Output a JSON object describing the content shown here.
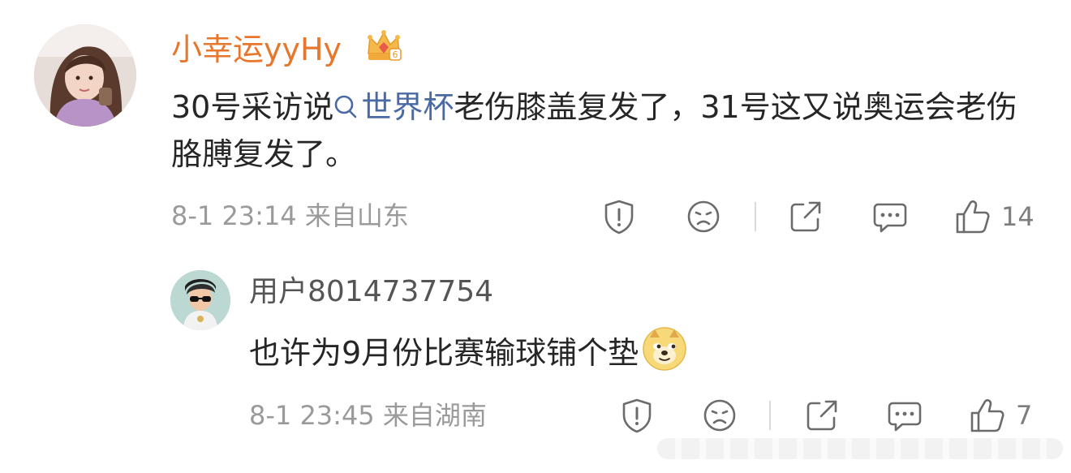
{
  "comment": {
    "username": "小幸运yyHy",
    "badge_icon": "vip-crown-icon",
    "text_before": "30号采访说",
    "topic_icon": "search-icon",
    "topic": "世界杯",
    "text_after": "老伤膝盖复发了，31号这又说奥运会老伤胳膊复发了。",
    "timestamp": "8-1 23:14",
    "location": "来自山东",
    "like_count": "14",
    "actions": [
      "report-icon",
      "dislike-icon",
      "share-icon",
      "reply-icon",
      "like-icon"
    ]
  },
  "reply": {
    "username": "用户8014737754",
    "text": "也许为9月份比赛输球铺个垫",
    "emoji": "doge-emoji-icon",
    "timestamp": "8-1 23:45",
    "location": "来自湖南",
    "like_count": "7",
    "actions": [
      "report-icon",
      "dislike-icon",
      "share-icon",
      "reply-icon",
      "like-icon"
    ]
  },
  "colors": {
    "username_vip": "#e8772e",
    "topic_link": "#4a6aa5",
    "meta_gray": "#9a9a9a"
  }
}
